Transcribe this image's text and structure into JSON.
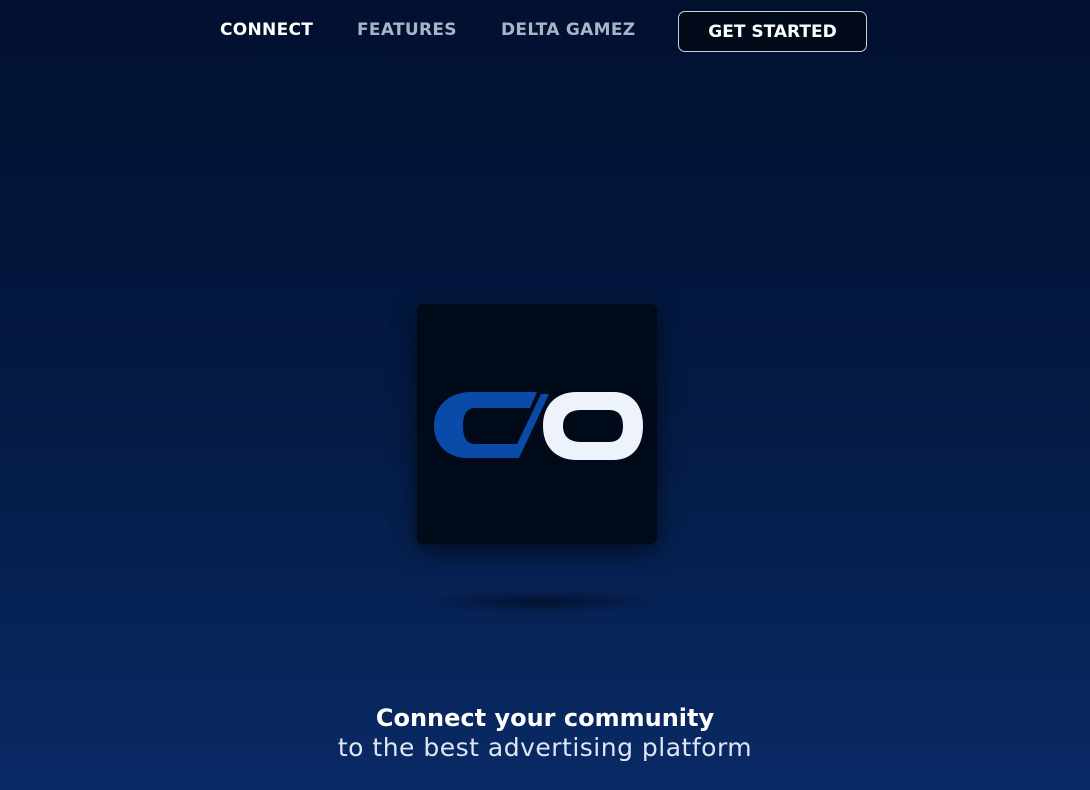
{
  "nav": {
    "links": [
      {
        "label": "CONNECT",
        "active": true
      },
      {
        "label": "FEATURES",
        "active": false
      },
      {
        "label": "DELTA GAMEZ",
        "active": false
      }
    ],
    "cta_label": "GET STARTED"
  },
  "hero": {
    "logo_icon": "connect-logo-icon",
    "tagline_strong": "Connect your community",
    "tagline_light": "to the best advertising platform"
  },
  "colors": {
    "background_top": "#021030",
    "background_bottom": "#0a2a66",
    "logo_blue": "#0a4aa8",
    "logo_white": "#eef2fb",
    "tile": "#000a19"
  }
}
